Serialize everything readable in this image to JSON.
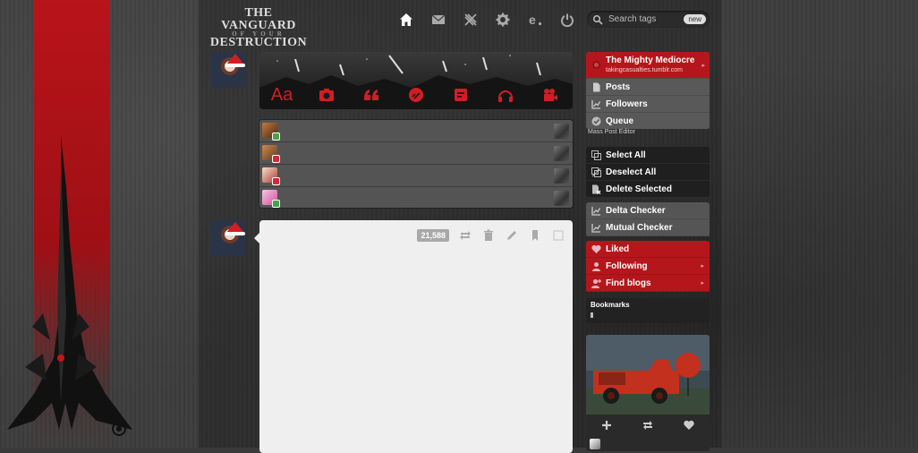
{
  "header": {
    "logo_line1": "THE VANGUARD",
    "logo_line2": "OF YOUR",
    "logo_line3": "DESTRUCTION",
    "nav": [
      "home-icon",
      "mail-icon",
      "x-logo-icon",
      "gear-icon",
      "activity-e-icon",
      "power-icon"
    ],
    "search_placeholder": "Search tags",
    "search_badge": "new"
  },
  "compose": {
    "text_label": "Aa",
    "icons": [
      "text-icon",
      "camera-icon",
      "quote-icon",
      "link-icon",
      "chat-icon",
      "audio-headphones-icon",
      "video-camera-icon"
    ]
  },
  "post": {
    "note_count": "21,588"
  },
  "sidebar": {
    "blog": {
      "name": "The Mighty Mediocre",
      "url": "takingcasualties.tumblr.com",
      "items": [
        "Posts",
        "Followers",
        "Queue"
      ]
    },
    "mass_post_editor": "Mass Post Editor",
    "mass_actions": [
      "Select All",
      "Deselect All",
      "Delete Selected"
    ],
    "checkers": [
      "Delta Checker",
      "Mutual Checker"
    ],
    "account": [
      "Liked",
      "Following",
      "Find blogs"
    ],
    "bookmarks_title": "Bookmarks"
  },
  "colors": {
    "accent_red": "#b5161b",
    "compose_icon_red": "#d01e24",
    "post_bg": "#efefef",
    "background": "#3d3d3d"
  }
}
